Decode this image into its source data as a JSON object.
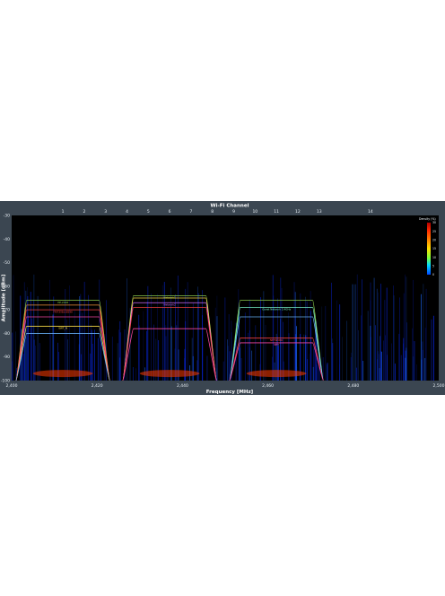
{
  "chart_data": {
    "type": "heatmap",
    "title": "",
    "top_axis": {
      "label": "Wi-Fi Channel",
      "channels": [
        {
          "channel": "1",
          "freq": 2412
        },
        {
          "channel": "2",
          "freq": 2417
        },
        {
          "channel": "3",
          "freq": 2422
        },
        {
          "channel": "4",
          "freq": 2427
        },
        {
          "channel": "5",
          "freq": 2432
        },
        {
          "channel": "6",
          "freq": 2437
        },
        {
          "channel": "7",
          "freq": 2442
        },
        {
          "channel": "8",
          "freq": 2447
        },
        {
          "channel": "9",
          "freq": 2452
        },
        {
          "channel": "10",
          "freq": 2457
        },
        {
          "channel": "11",
          "freq": 2462
        },
        {
          "channel": "12",
          "freq": 2467
        },
        {
          "channel": "13",
          "freq": 2472
        },
        {
          "channel": "14",
          "freq": 2484
        }
      ]
    },
    "xlabel": "Frequency [MHz]",
    "ylabel": "Amplitude [dBm]",
    "xlim": [
      2400,
      2500
    ],
    "ylim": [
      -100,
      -30
    ],
    "x_ticks": [
      "2,400",
      "2,420",
      "2,440",
      "2,460",
      "2,480",
      "2,500"
    ],
    "y_ticks": [
      "-30",
      "-40",
      "-50",
      "-60",
      "-70",
      "-80",
      "-90",
      "-100"
    ],
    "colorbar": {
      "label": "Density (%)",
      "ticks": [
        "30",
        "25",
        "20",
        "15",
        "10",
        "5",
        "0"
      ],
      "colors": [
        "#b00000",
        "#ff2a00",
        "#ff8c00",
        "#ffe000",
        "#7dff3a",
        "#00d9ff",
        "#0044ff"
      ]
    },
    "networks": [
      {
        "center": 2412,
        "peak_dbm": -66,
        "color": "#8fd14f",
        "ssid": "HP-2018"
      },
      {
        "center": 2412,
        "peak_dbm": -68,
        "color": "#ff9a3c",
        "ssid": ""
      },
      {
        "center": 2412,
        "peak_dbm": -70,
        "color": "#ff4545",
        "ssid": "FRITZ!Box6590"
      },
      {
        "center": 2412,
        "peak_dbm": -73,
        "color": "#ff4aa8",
        "ssid": ""
      },
      {
        "center": 2412,
        "peak_dbm": -77,
        "color": "#ffe14a",
        "ssid": "SWT_N"
      },
      {
        "center": 2412,
        "peak_dbm": -80,
        "color": "#6db7ff",
        "ssid": ""
      },
      {
        "center": 2437,
        "peak_dbm": -64,
        "color": "#8fd14f",
        "ssid": "Network1"
      },
      {
        "center": 2437,
        "peak_dbm": -65,
        "color": "#ffe14a",
        "ssid": ""
      },
      {
        "center": 2437,
        "peak_dbm": -67,
        "color": "#d46cff",
        "ssid": "Network2"
      },
      {
        "center": 2437,
        "peak_dbm": -69,
        "color": "#ff4545",
        "ssid": ""
      },
      {
        "center": 2437,
        "peak_dbm": -78,
        "color": "#ff4aa8",
        "ssid": ""
      },
      {
        "center": 2462,
        "peak_dbm": -66,
        "color": "#8fd14f",
        "ssid": ""
      },
      {
        "center": 2462,
        "peak_dbm": -69,
        "color": "#7fffd4",
        "ssid": "Guest Network 2.4GHz"
      },
      {
        "center": 2462,
        "peak_dbm": -73,
        "color": "#6db7ff",
        "ssid": ""
      },
      {
        "center": 2462,
        "peak_dbm": -82,
        "color": "#ff4545",
        "ssid": "NETWORK"
      },
      {
        "center": 2462,
        "peak_dbm": -84,
        "color": "#ff4aa8",
        "ssid": "NET"
      }
    ]
  }
}
